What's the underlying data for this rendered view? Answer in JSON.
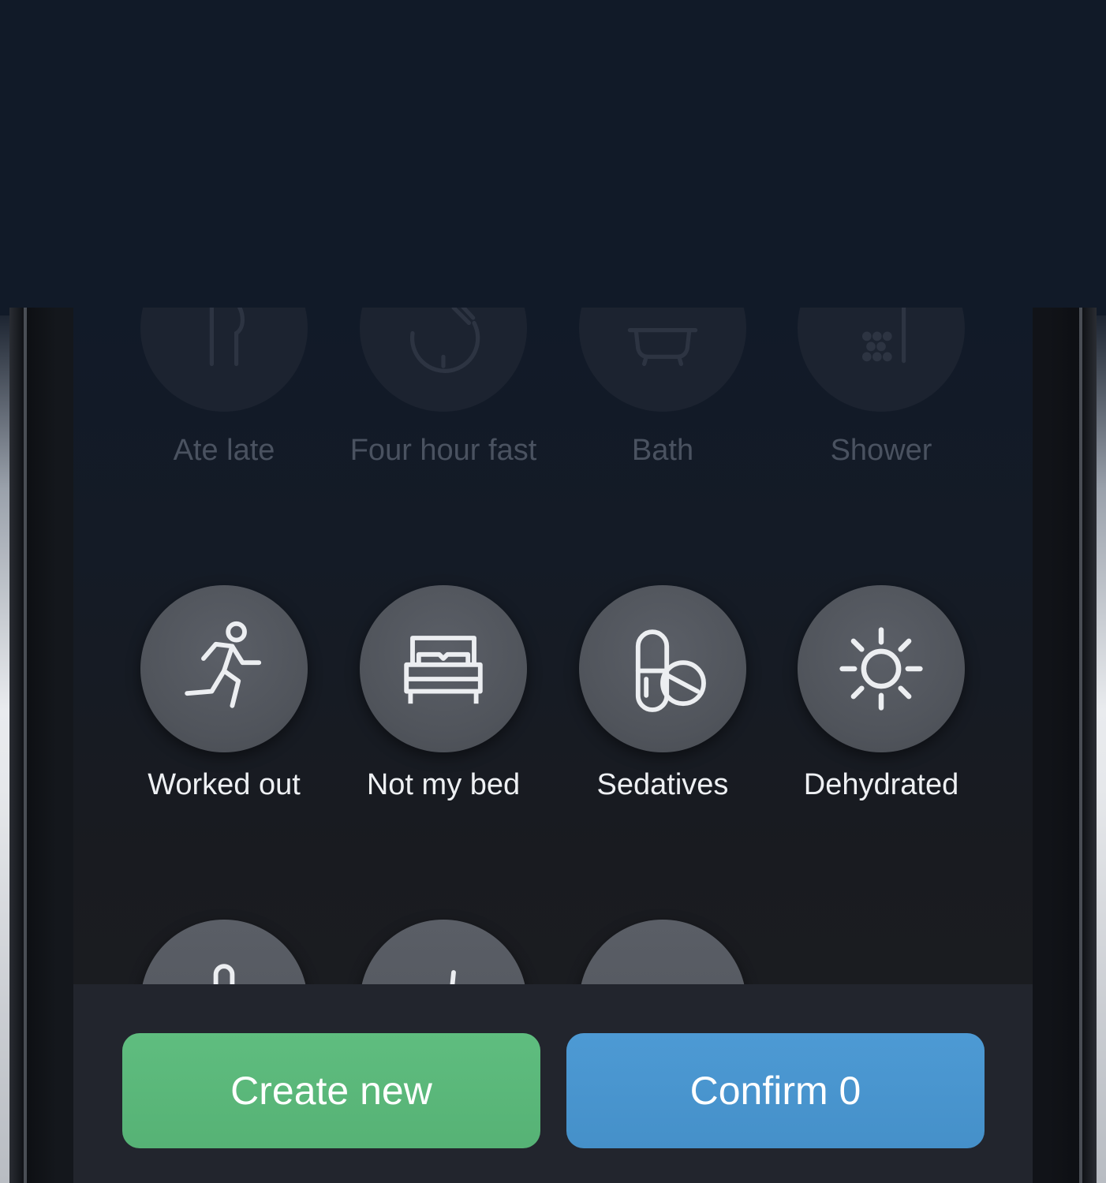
{
  "activities": {
    "row1": [
      {
        "label": "Ate late",
        "icon": "fork-knife-icon"
      },
      {
        "label": "Four hour fast",
        "icon": "clock-fast-icon"
      },
      {
        "label": "Bath",
        "icon": "bathtub-icon"
      },
      {
        "label": "Shower",
        "icon": "shower-icon"
      }
    ],
    "row2": [
      {
        "label": "Worked out",
        "icon": "running-person-icon"
      },
      {
        "label": "Not my bed",
        "icon": "bed-icon"
      },
      {
        "label": "Sedatives",
        "icon": "pills-icon"
      },
      {
        "label": "Dehydrated",
        "icon": "sun-icon"
      }
    ],
    "row3": [
      {
        "icon": "thermometer-icon"
      },
      {
        "icon": "drink-icon"
      },
      {
        "icon": "capsule-icon"
      }
    ]
  },
  "actions": {
    "create_label": "Create new",
    "confirm_label": "Confirm 0"
  },
  "colors": {
    "create_button": "#5cb97b",
    "confirm_button": "#4995cf",
    "background": "#111a28"
  }
}
